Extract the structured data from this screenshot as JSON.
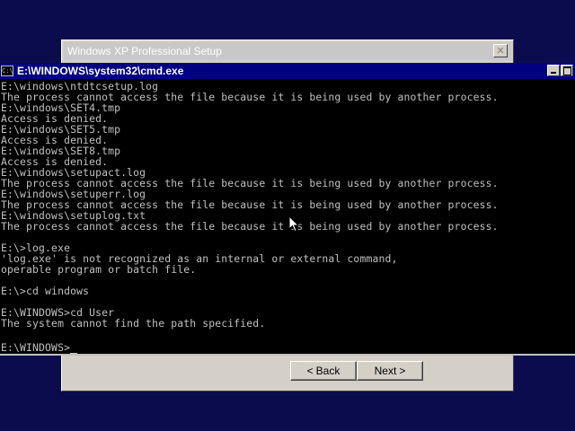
{
  "setup": {
    "title": "Windows XP Professional Setup",
    "close_glyph": "✕",
    "back_label": "Back",
    "back_arrow": "<",
    "next_label": "Next",
    "next_arrow": ">"
  },
  "cmd": {
    "title": "E:\\WINDOWS\\system32\\cmd.exe",
    "icon_text": "C:\\",
    "lines": [
      "E:\\windows\\ntdtcsetup.log",
      "The process cannot access the file because it is being used by another process.",
      "E:\\windows\\SET4.tmp",
      "Access is denied.",
      "E:\\windows\\SET5.tmp",
      "Access is denied.",
      "E:\\windows\\SET8.tmp",
      "Access is denied.",
      "E:\\windows\\setupact.log",
      "The process cannot access the file because it is being used by another process.",
      "E:\\windows\\setuperr.log",
      "The process cannot access the file because it is being used by another process.",
      "E:\\windows\\setuplog.txt",
      "The process cannot access the file because it is being used by another process.",
      "",
      "E:\\>log.exe",
      "'log.exe' is not recognized as an internal or external command,",
      "operable program or batch file.",
      "",
      "E:\\>cd windows",
      "",
      "E:\\WINDOWS>cd User",
      "The system cannot find the path specified.",
      "",
      "E:\\WINDOWS>"
    ]
  },
  "colors": {
    "desktop": "#0a0c4e",
    "console_bg": "#000000",
    "console_text": "#c0c0c0",
    "titlebar_active": "#000080"
  },
  "icons": [
    "close-icon",
    "minimize-icon",
    "maximize-icon",
    "cmd-icon",
    "mouse-pointer-icon"
  ]
}
